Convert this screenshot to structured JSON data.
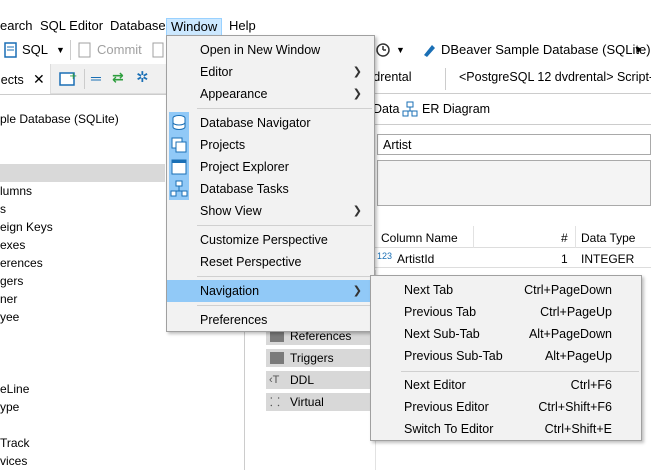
{
  "menubar": {
    "items": [
      {
        "label": "earch"
      },
      {
        "label": "SQL Editor"
      },
      {
        "label": "Database"
      },
      {
        "label": "Window"
      },
      {
        "label": "Help"
      }
    ]
  },
  "toolbar": {
    "sql_label": "SQL",
    "commit_label": "Commit",
    "db_selector": "DBeaver Sample Database (SQLite)"
  },
  "left_panel": {
    "tab_label": "jects",
    "tree": [
      "ple Database (SQLite)",
      "",
      "",
      "lumns",
      "s",
      "eign Keys",
      "exes",
      "erences",
      "gers",
      "ner",
      "yee",
      "",
      "",
      "",
      "eLine",
      "ype",
      "",
      "Track",
      "vices"
    ]
  },
  "editor": {
    "tabs": [
      "vdrental",
      "<PostgreSQL 12 dvdrental> Script-"
    ],
    "subtabs": [
      "Data",
      "ER Diagram"
    ],
    "table_name": "Artist",
    "columns_header": {
      "name": "Column Name",
      "num": "#",
      "type": "Data Type"
    },
    "rows": [
      {
        "name": "ArtistId",
        "num": "1",
        "type": "INTEGER"
      }
    ],
    "side_list": [
      "References",
      "Triggers",
      "DDL",
      "Virtual"
    ]
  },
  "window_menu": {
    "items": [
      {
        "label": "Open in New Window"
      },
      {
        "label": "Editor",
        "submenu": true
      },
      {
        "label": "Appearance",
        "submenu": true
      },
      {
        "label": "Database Navigator",
        "icon": "database-navigator-icon"
      },
      {
        "label": "Projects",
        "icon": "projects-icon"
      },
      {
        "label": "Project Explorer",
        "icon": "project-explorer-icon"
      },
      {
        "label": "Database Tasks",
        "icon": "database-tasks-icon"
      },
      {
        "label": "Show View",
        "submenu": true
      },
      {
        "label": "Customize Perspective"
      },
      {
        "label": "Reset Perspective"
      },
      {
        "label": "Navigation",
        "submenu": true
      },
      {
        "label": "Preferences"
      }
    ]
  },
  "navigation_menu": {
    "items": [
      {
        "label": "Next Tab",
        "shortcut": "Ctrl+PageDown"
      },
      {
        "label": "Previous Tab",
        "shortcut": "Ctrl+PageUp"
      },
      {
        "label": "Next Sub-Tab",
        "shortcut": "Alt+PageDown"
      },
      {
        "label": "Previous Sub-Tab",
        "shortcut": "Alt+PageUp"
      },
      {
        "label": "Next Editor",
        "shortcut": "Ctrl+F6"
      },
      {
        "label": "Previous Editor",
        "shortcut": "Ctrl+Shift+F6"
      },
      {
        "label": "Switch To Editor",
        "shortcut": "Ctrl+Shift+E"
      }
    ]
  },
  "colors": {
    "highlight": "#91c9f7",
    "menu_bg": "#f2f2f2",
    "active_menubar": "#cce8ff"
  }
}
